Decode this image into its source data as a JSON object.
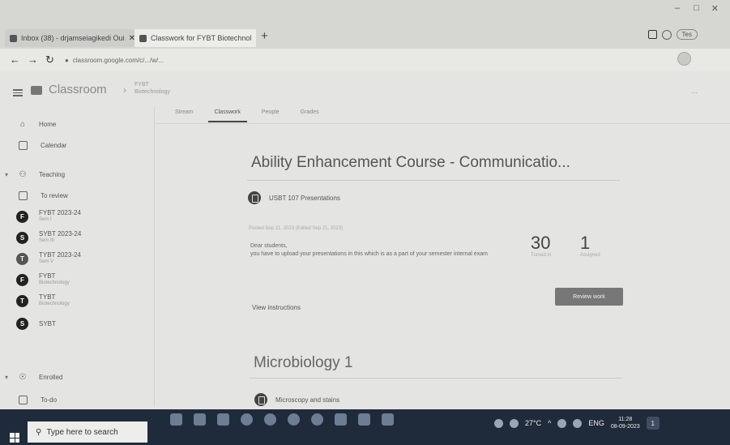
{
  "browser": {
    "tabs": [
      {
        "title": "Inbox (38) - drjamseiagikedi Oui"
      },
      {
        "title": "Classwork for FYBT Biotechnol"
      }
    ],
    "new_tab": "+",
    "address": "classroom.google.com/c/.../w/...",
    "profile_label": "Tes",
    "window_controls": {
      "minimize": "–",
      "maximize": "□",
      "close": "✕"
    }
  },
  "app": {
    "title": "Classroom",
    "breadcrumb_class": "FYBT",
    "breadcrumb_sub": "Biotechnology"
  },
  "sidebar": {
    "items": [
      {
        "label": "Home",
        "icon": "home-icon"
      },
      {
        "label": "Calendar",
        "icon": "calendar-icon"
      },
      {
        "label": "Teaching",
        "icon": "people-icon"
      },
      {
        "label": "To review",
        "icon": "folder-icon"
      },
      {
        "label": "FYBT 2023-24",
        "sub": "Sem I",
        "avatar": "F"
      },
      {
        "label": "SYBT 2023-24",
        "sub": "Sem III",
        "avatar": "S"
      },
      {
        "label": "TYBT 2023-24",
        "sub": "Sem V",
        "avatar": "T"
      },
      {
        "label": "FYBT",
        "sub": "Biotechnology",
        "avatar": "F"
      },
      {
        "label": "TYBT",
        "sub": "Biotechnology",
        "avatar": "T"
      },
      {
        "label": "SYBT",
        "sub": "",
        "avatar": "S"
      },
      {
        "label": "Enrolled",
        "icon": "school-icon"
      },
      {
        "label": "To-do",
        "icon": "checklist-icon"
      }
    ]
  },
  "tabs": [
    "Stream",
    "Classwork",
    "People",
    "Grades"
  ],
  "course": {
    "title": "Ability Enhancement Course - Communicatio...",
    "assignment": "USBT 107 Presentations",
    "posted": "Posted Sep 21, 2023 (Edited Sep 21, 2023)",
    "description": "Dear students,\nyou have to upload your presentations in this which is as a part of your semester internal exam",
    "stats": [
      {
        "value": "30",
        "label": "Turned in"
      },
      {
        "value": "1",
        "label": "Assigned"
      }
    ],
    "review_button": "Review work",
    "view_instructions": "View instructions"
  },
  "section2": {
    "title": "Microbiology 1",
    "assignment": "Microscopy and stains"
  },
  "taskbar": {
    "search_placeholder": "Type here to search",
    "weather": "27°C",
    "language": "ENG",
    "time": "11:28",
    "date": "08-09-2023",
    "notification_count": "1"
  }
}
